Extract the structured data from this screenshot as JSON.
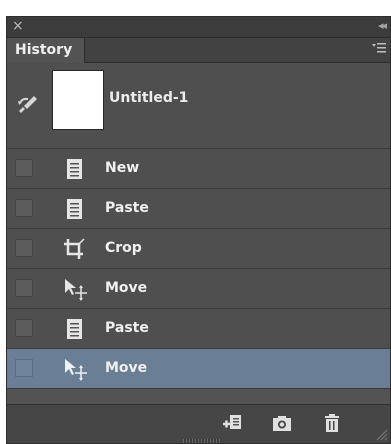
{
  "panel": {
    "close_glyph": "×",
    "collapse_glyph": "◂◂",
    "tab_label": "History"
  },
  "snapshot": {
    "label": "Untitled-1",
    "icon": "history-brush-icon"
  },
  "states": [
    {
      "label": "New",
      "icon": "document-icon",
      "selected": false
    },
    {
      "label": "Paste",
      "icon": "document-icon",
      "selected": false
    },
    {
      "label": "Crop",
      "icon": "crop-icon",
      "selected": false
    },
    {
      "label": "Move",
      "icon": "move-tool-icon",
      "selected": false
    },
    {
      "label": "Paste",
      "icon": "document-icon",
      "selected": false
    },
    {
      "label": "Move",
      "icon": "move-tool-icon",
      "selected": true
    }
  ],
  "footer": {
    "buttons": [
      "new-document-from-state-icon",
      "camera-icon",
      "trash-icon"
    ]
  },
  "colors": {
    "panel_bg": "#535353",
    "selected_row": "#6a7f95"
  }
}
